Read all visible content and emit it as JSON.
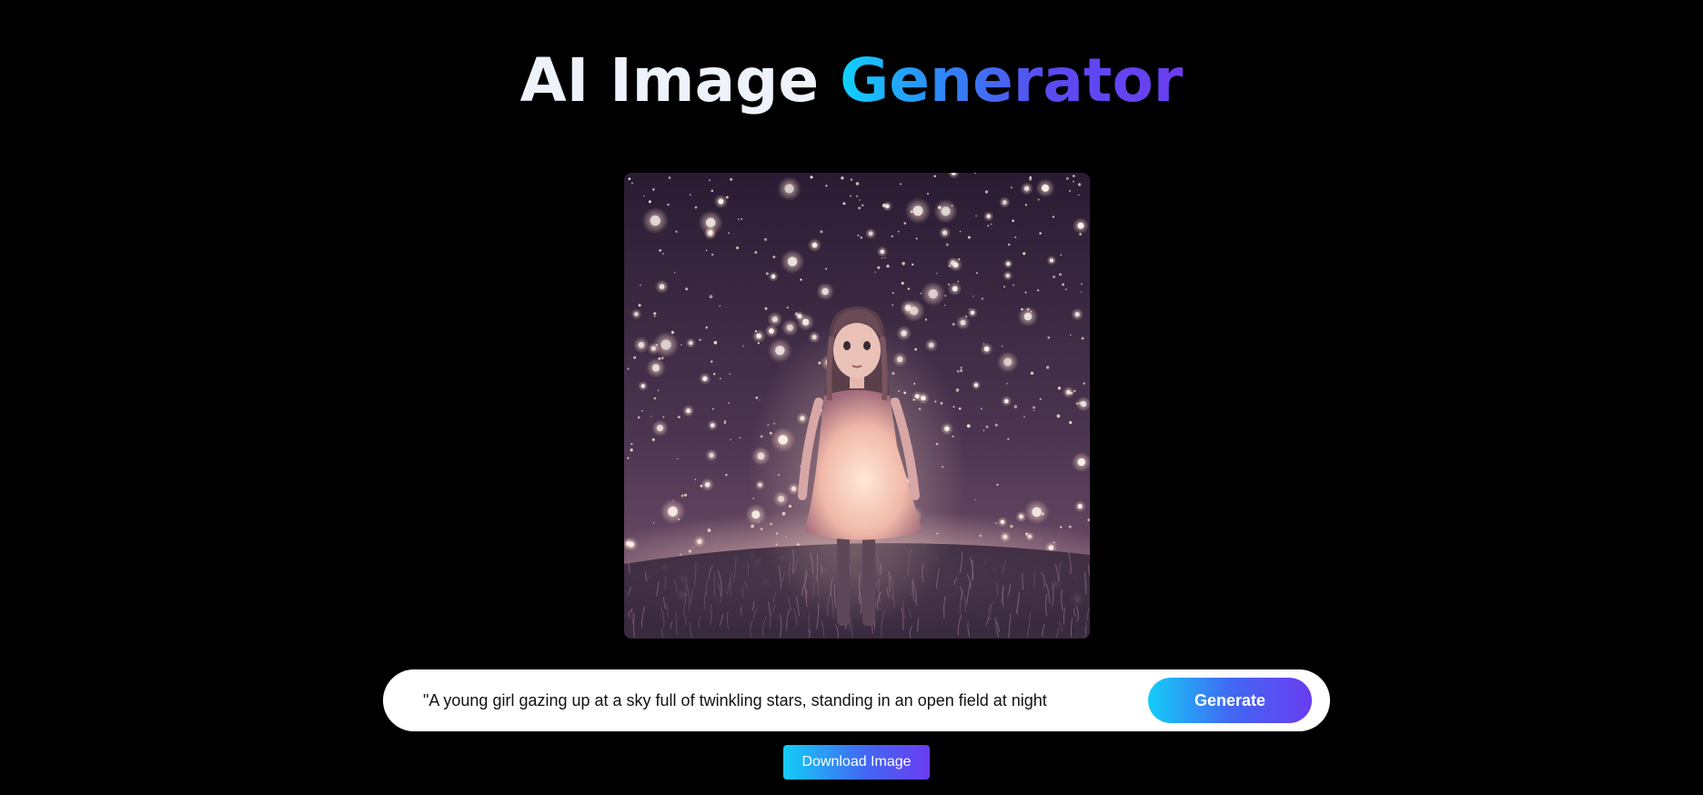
{
  "header": {
    "title_plain": "AI Image",
    "title_accent": "Generator"
  },
  "generated_image": {
    "icon": "generated-artwork-image",
    "colors": {
      "sky_top": "#2a1c33",
      "sky_bottom": "#5b3f5f",
      "ground": "#3a2a3d",
      "glow": "#ffd7c4"
    }
  },
  "prompt": {
    "value": "\"A young girl gazing up at a sky full of twinkling stars, standing in an open field at night"
  },
  "actions": {
    "generate_label": "Generate",
    "download_label": "Download Image"
  },
  "colors": {
    "background": "#000000",
    "accent_start": "#0fd2ff",
    "accent_end": "#6a3ef0"
  }
}
